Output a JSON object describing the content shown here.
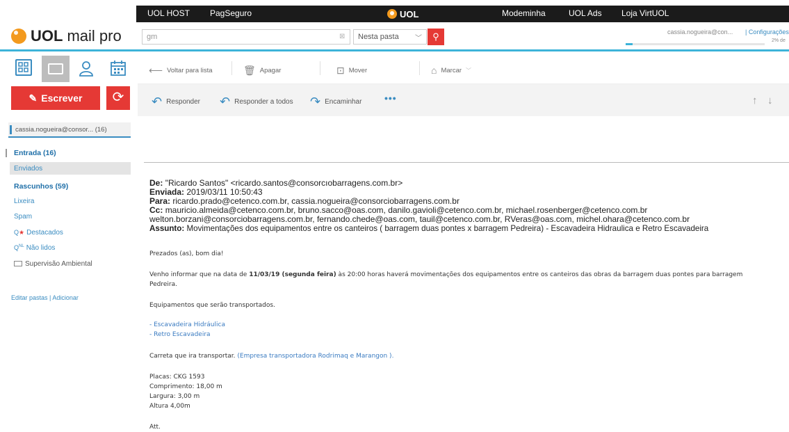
{
  "topnav": {
    "links": [
      "UOL HOST",
      "PagSeguro",
      "Modeminha",
      "UOL Ads",
      "Loja VirtUOL"
    ],
    "center_logo": "UOL"
  },
  "brand": {
    "uol": "UOL",
    "product": "mail pro"
  },
  "search": {
    "value": "gm",
    "folder_scope": "Nesta pasta"
  },
  "account": {
    "name": "cassia.nogueira@con...",
    "config_link": "| Configurações",
    "quota_text": "2% de",
    "quota_fraction": 0.05
  },
  "sidebar": {
    "write_label": "Escrever",
    "account_chip": "cassia.nogueira@consor... (16)",
    "folders": [
      {
        "label": "Entrada (16)"
      },
      {
        "label": "Enviados"
      },
      {
        "label": "Rascunhos (59)"
      },
      {
        "label": "Lixeira"
      },
      {
        "label": "Spam"
      },
      {
        "label": "Destacados"
      },
      {
        "label": "Não lidos"
      },
      {
        "label": "Supervisão Ambiental"
      }
    ],
    "edit_folders": "Editar pastas | Adicionar"
  },
  "toolbar": {
    "back": "Voltar para lista",
    "delete": "Apagar",
    "move": "Mover",
    "mark": "Marcar"
  },
  "actions": {
    "reply": "Responder",
    "reply_all": "Responder a todos",
    "forward": "Encaminhar",
    "more": "•••"
  },
  "email": {
    "from_label": "De:",
    "from_value": "\"Ricardo Santos\" <ricardo.santos@consorcıobarragens.com.br>",
    "sent_label": "Enviada:",
    "sent_value": "2019/03/11 10:50:43",
    "to_label": "Para:",
    "to_value": "ricardo.prado@cetenco.com.br, cassia.nogueira@consorciobarragens.com.br",
    "cc_label": "Cc:",
    "cc_value_1": "mauricio.almeida@cetenco.com.br, bruno.sacco@oas.com, danilo.gavioli@cetenco.com.br, michael.rosenberger@cetenco.com.br",
    "cc_value_2": "welton.borzani@consorciobarragens.com.br, fernando.chede@oas.com, tauil@cetenco.com.br, RVeras@oas.com, michel.ohara@cetenco.com.br",
    "subject_label": "Assunto:",
    "subject_value": "Movimentações dos equipamentos entre os canteiros ( barragem duas pontes x barragem Pedreira) - Escavadeira Hidraulica e Retro Escavadeira",
    "greeting": "Prezados (as), bom dia!",
    "p1_pre": "Venho informar que na data de ",
    "p1_bold": "11/03/19 (segunda feira)",
    "p1_post": " às 20:00 horas haverá movimentações dos equipamentos entre os canteiros das obras da barragem duas pontes para barragem",
    "p1_line2": "Pedreira.",
    "equip_intro": "Equipamentos que serão transportados.",
    "equip_1": "- Escavadeira Hidráulica",
    "equip_2": "- Retro Escavadeira",
    "carrier_pre": "Carreta que ira transportar. ",
    "carrier_blue": "(Empresa transportadora Rodrimaq e Marangon ).",
    "plate": "Placas: CKG 1593",
    "length": "Comprimento: 18,00 m",
    "width": "Largura: 3,00 m",
    "height": "Altura 4,00m",
    "signoff": "Att."
  }
}
